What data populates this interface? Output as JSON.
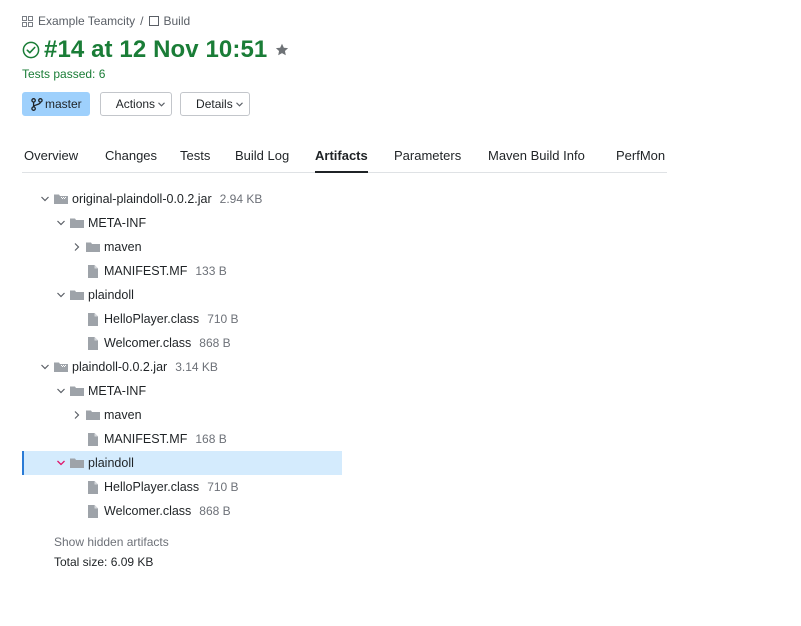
{
  "breadcrumb": {
    "project": "Example Teamcity",
    "separator": "/",
    "build": "Build"
  },
  "build": {
    "title": "#14 at 12 Nov 10:51",
    "status_text": "Tests passed: 6"
  },
  "buttons": {
    "branch": "master",
    "actions": "Actions",
    "details": "Details"
  },
  "tabs": [
    {
      "label": "Overview"
    },
    {
      "label": "Changes"
    },
    {
      "label": "Tests"
    },
    {
      "label": "Build Log"
    },
    {
      "label": "Artifacts",
      "active": true
    },
    {
      "label": "Parameters"
    },
    {
      "label": "Maven Build Info"
    },
    {
      "label": "PerfMon"
    }
  ],
  "tree": [
    {
      "type": "archive",
      "name": "original-plaindoll-0.0.2.jar",
      "size": "2.94 KB",
      "expanded": true
    },
    {
      "type": "folder",
      "name": "META-INF",
      "expanded": true
    },
    {
      "type": "folder",
      "name": "maven",
      "expanded": false
    },
    {
      "type": "file",
      "name": "MANIFEST.MF",
      "size": "133 B"
    },
    {
      "type": "folder",
      "name": "plaindoll",
      "expanded": true
    },
    {
      "type": "file",
      "name": "HelloPlayer.class",
      "size": "710 B"
    },
    {
      "type": "file",
      "name": "Welcomer.class",
      "size": "868 B"
    },
    {
      "type": "archive",
      "name": "plaindoll-0.0.2.jar",
      "size": "3.14 KB",
      "expanded": true
    },
    {
      "type": "folder",
      "name": "META-INF",
      "expanded": true
    },
    {
      "type": "folder",
      "name": "maven",
      "expanded": false
    },
    {
      "type": "file",
      "name": "MANIFEST.MF",
      "size": "168 B"
    },
    {
      "type": "folder",
      "name": "plaindoll",
      "expanded": true,
      "selected": true
    },
    {
      "type": "file",
      "name": "HelloPlayer.class",
      "size": "710 B"
    },
    {
      "type": "file",
      "name": "Welcomer.class",
      "size": "868 B"
    }
  ],
  "footer": {
    "show_hidden": "Show hidden artifacts",
    "total_size": "Total size: 6.09 KB"
  },
  "colors": {
    "success": "#1a7d37",
    "branch_bg": "#9ed0fc",
    "selected_row": "#d4ebfd",
    "selected_toggle": "#e0156b",
    "folder": "#9ea3a9"
  }
}
